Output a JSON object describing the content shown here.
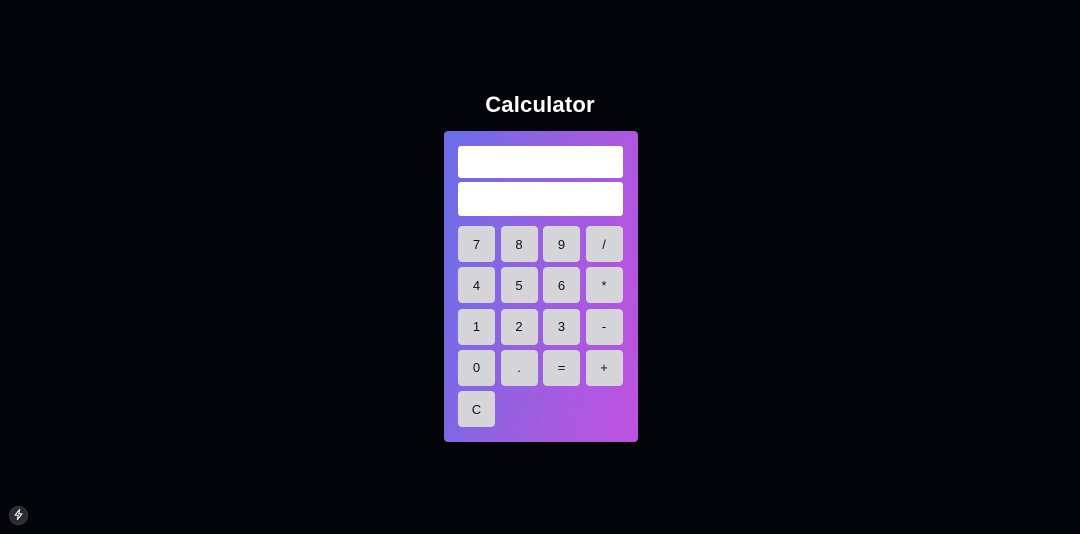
{
  "page": {
    "title": "Calculator"
  },
  "display": {
    "expression": "",
    "result": ""
  },
  "keys": [
    {
      "label": "7",
      "name": "key-7"
    },
    {
      "label": "8",
      "name": "key-8"
    },
    {
      "label": "9",
      "name": "key-9"
    },
    {
      "label": "/",
      "name": "key-divide"
    },
    {
      "label": "4",
      "name": "key-4"
    },
    {
      "label": "5",
      "name": "key-5"
    },
    {
      "label": "6",
      "name": "key-6"
    },
    {
      "label": "*",
      "name": "key-multiply"
    },
    {
      "label": "1",
      "name": "key-1"
    },
    {
      "label": "2",
      "name": "key-2"
    },
    {
      "label": "3",
      "name": "key-3"
    },
    {
      "label": "-",
      "name": "key-subtract"
    },
    {
      "label": "0",
      "name": "key-0"
    },
    {
      "label": ".",
      "name": "key-decimal"
    },
    {
      "label": "=",
      "name": "key-equals"
    },
    {
      "label": "+",
      "name": "key-add"
    },
    {
      "label": "C",
      "name": "key-clear"
    }
  ],
  "badge": {
    "icon": "lightning-bolt-icon"
  },
  "colors": {
    "background": "#04050b",
    "gradient_start": "#6a6fe8",
    "gradient_end": "#c050e0",
    "key": "#d4d4d9",
    "display": "#ffffff"
  }
}
